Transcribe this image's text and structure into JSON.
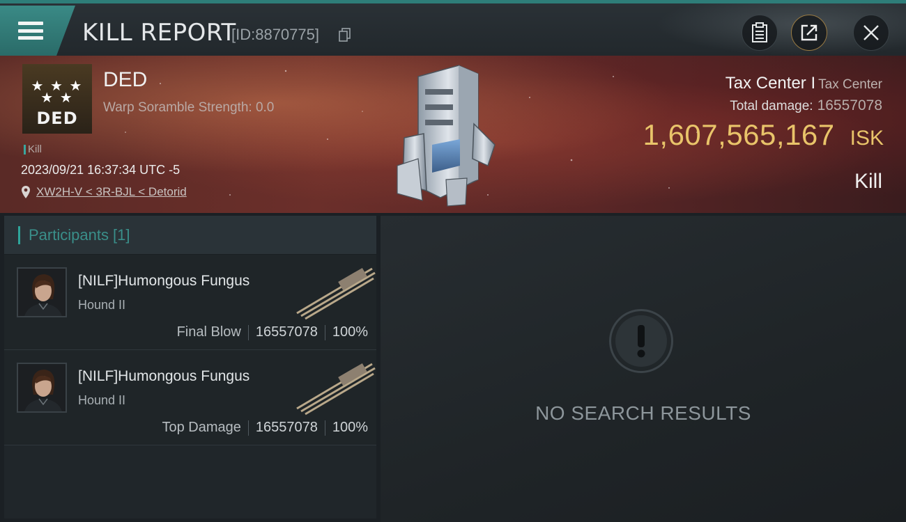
{
  "header": {
    "title": "KILL REPORT",
    "report_id": "[ID:8870775]",
    "menu_icon": "hamburger-icon",
    "actions": [
      {
        "icon": "clipboard-icon"
      },
      {
        "icon": "share-icon"
      },
      {
        "icon": "close-icon"
      }
    ]
  },
  "victim": {
    "logo_text": "DED",
    "logo_stars": "★ ★ ★ ★ ★",
    "name": "DED",
    "warp_scramble": "Warp Soramble Strength: 0.0",
    "tag": "Kill",
    "datetime": "2023/09/21 16:37:34 UTC -5",
    "location": "XW2H-V < 3R-BJL < Detorid"
  },
  "target": {
    "name": "Tax Center I",
    "type": "Tax Center",
    "total_damage_label": "Total damage:",
    "total_damage": "16557078",
    "isk_value": "1,607,565,167",
    "isk_unit": "ISK",
    "result": "Kill"
  },
  "participants": {
    "title": "Participants [1]",
    "rows": [
      {
        "name": "[NILF]Humongous Fungus",
        "ship": "Hound II",
        "label": "Final Blow",
        "damage": "16557078",
        "percent": "100%"
      },
      {
        "name": "[NILF]Humongous Fungus",
        "ship": "Hound II",
        "label": "Top Damage",
        "damage": "16557078",
        "percent": "100%"
      }
    ]
  },
  "results": {
    "empty_text": "NO SEARCH RESULTS"
  },
  "colors": {
    "accent": "#2e7d79",
    "isk": "#e9c46a",
    "banner": "#6b2f2a"
  }
}
